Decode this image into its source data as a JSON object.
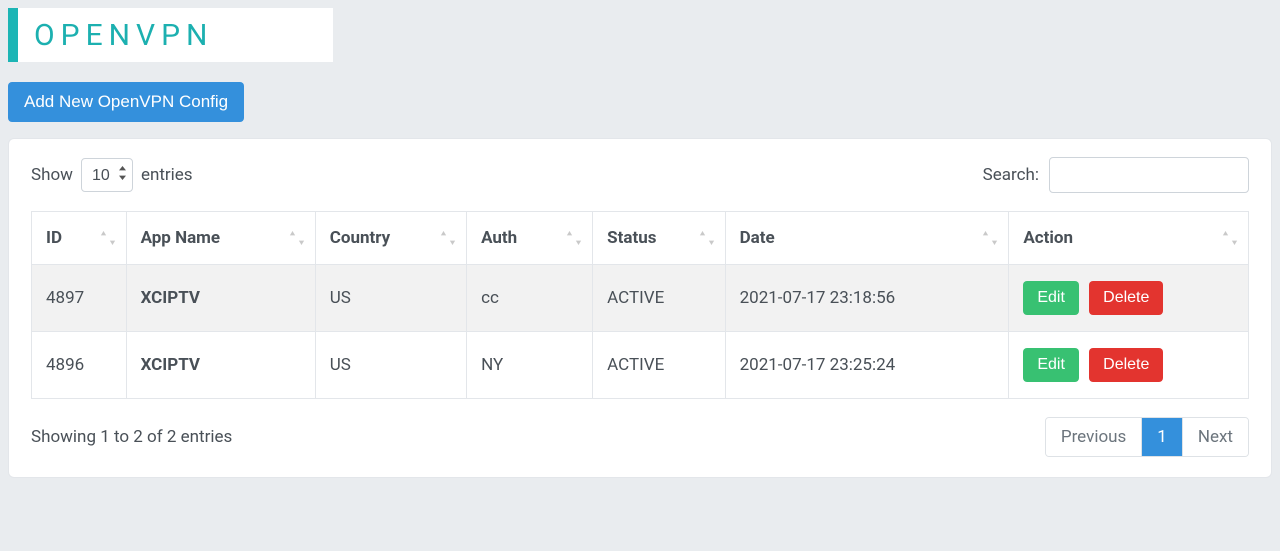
{
  "logo": {
    "text": "OPENVPN"
  },
  "buttons": {
    "add_config": "Add New OpenVPN Config",
    "edit": "Edit",
    "delete": "Delete"
  },
  "length": {
    "show": "Show",
    "entries": "entries",
    "value": "10"
  },
  "search": {
    "label": "Search:",
    "value": ""
  },
  "columns": {
    "id": "ID",
    "app": "App Name",
    "country": "Country",
    "auth": "Auth",
    "status": "Status",
    "date": "Date",
    "action": "Action"
  },
  "rows": [
    {
      "id": "4897",
      "app": "XCIPTV",
      "country": "US",
      "auth": "cc",
      "status": "ACTIVE",
      "date": "2021-07-17 23:18:56"
    },
    {
      "id": "4896",
      "app": "XCIPTV",
      "country": "US",
      "auth": "NY",
      "status": "ACTIVE",
      "date": "2021-07-17 23:25:24"
    }
  ],
  "info": "Showing 1 to 2 of 2 entries",
  "paginate": {
    "prev": "Previous",
    "next": "Next",
    "current": "1"
  }
}
